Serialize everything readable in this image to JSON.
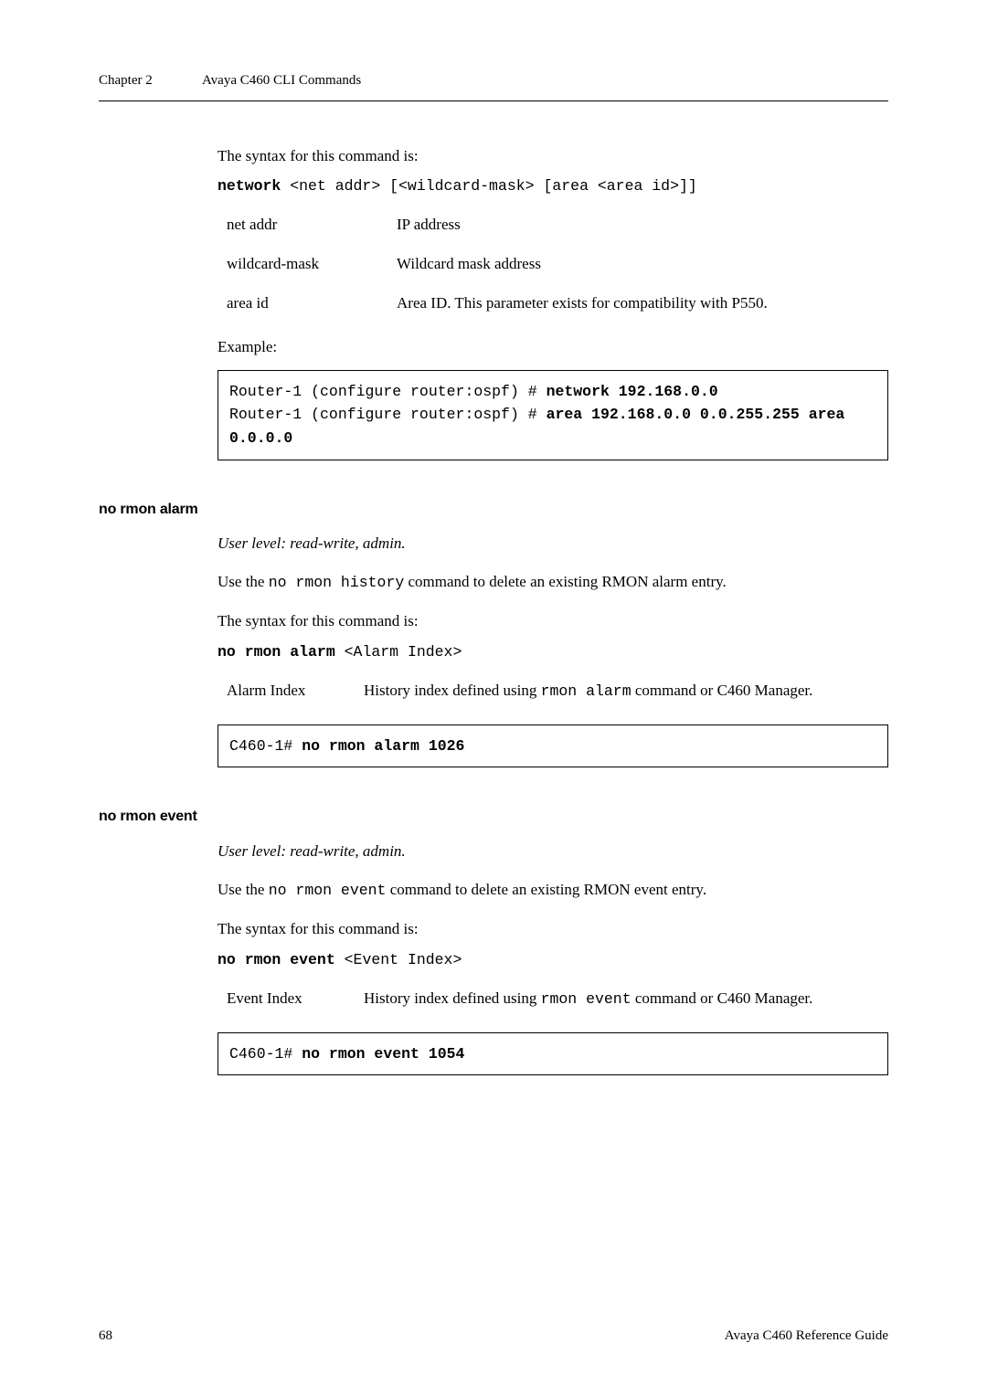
{
  "running_head": {
    "chapter_label": "Chapter 2",
    "chapter_title": "Avaya C460 CLI Commands"
  },
  "block1": {
    "syntax_intro": "The syntax for this command is:",
    "cmd_kw": "network",
    "cmd_rest": " <net addr> [<wildcard-mask> [area <area id>]]",
    "params": [
      {
        "term": "net addr",
        "def": "IP address"
      },
      {
        "term": "wildcard-mask",
        "def": "Wildcard mask address"
      },
      {
        "term": "area id",
        "def": "Area ID. This parameter exists for compatibility with P550."
      }
    ],
    "example_label": "Example:",
    "code_line1_left": "Router-1 (configure router:ospf) # ",
    "code_line1_bold": "network 192.168.0.0",
    "code_line2_left": "Router-1 (configure router:ospf) # ",
    "code_line2_bold": "area 192.168.0.0 0.0.255.255 area 0.0.0.0"
  },
  "section_alarm": {
    "heading": "no rmon alarm",
    "user_level": "User level: read-write, admin.",
    "desc_pre": "Use the ",
    "desc_code": "no rmon history",
    "desc_post": " command to delete an existing RMON alarm entry.",
    "syntax_intro": "The syntax for this command is:",
    "cmd_kw": "no rmon alarm",
    "cmd_rest": " <Alarm Index>",
    "param_term": "Alarm Index",
    "param_def_pre": "History index defined using ",
    "param_def_code": "rmon alarm",
    "param_def_post": " command or C460 Manager.",
    "box_prompt": "C460-1# ",
    "box_bold": "no rmon alarm 1026"
  },
  "section_event": {
    "heading": "no rmon event",
    "user_level": "User level: read-write, admin.",
    "desc_pre": "Use the ",
    "desc_code": "no rmon event",
    "desc_post": " command to delete an existing RMON event entry.",
    "syntax_intro": "The syntax for this command is:",
    "cmd_kw": "no rmon event",
    "cmd_rest": " <Event Index>",
    "param_term": "Event Index",
    "param_def_pre": "History index defined using ",
    "param_def_code": "rmon event",
    "param_def_post": " command or C460 Manager.",
    "box_prompt": "C460-1# ",
    "box_bold": "no rmon event 1054"
  },
  "footer": {
    "page_no": "68",
    "doc_title": "Avaya C460 Reference Guide"
  }
}
